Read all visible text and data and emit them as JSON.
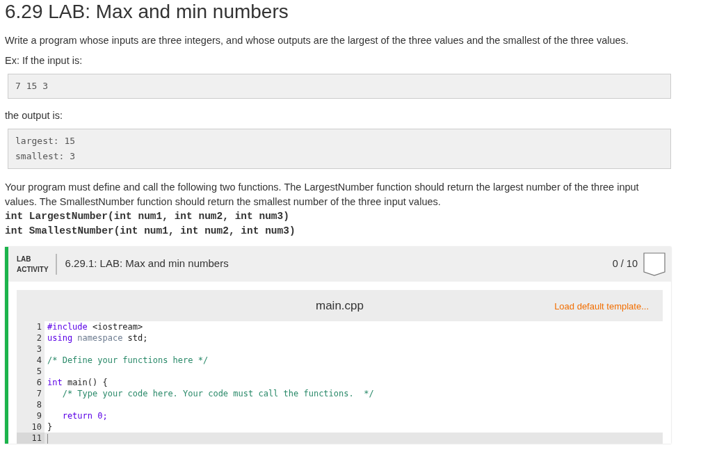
{
  "title": "6.29 LAB: Max and min numbers",
  "intro": "Write a program whose inputs are three integers, and whose outputs are the largest of the three values and the smallest of the three values.",
  "example_label": "Ex: If the input is:",
  "example_input": [
    "7 15 3"
  ],
  "output_label": "the output is:",
  "example_output": [
    "largest: 15",
    "smallest: 3"
  ],
  "functions_text": "Your program must define and call the following two functions. The LargestNumber function should return the largest number of the three input values. The SmallestNumber function should return the smallest number of the three input values.",
  "signatures": [
    "int LargestNumber(int num1, int num2, int num3)",
    "int SmallestNumber(int num1, int num2, int num3)"
  ],
  "activity": {
    "label_lines": [
      "LAB",
      "ACTIVITY"
    ],
    "title": "6.29.1: LAB: Max and min numbers",
    "score": "0 / 10"
  },
  "editor": {
    "filename": "main.cpp",
    "template_link": "Load default template...",
    "lines": [
      {
        "number": "1",
        "active": false,
        "tokens": [
          {
            "text": "#include",
            "kind": "keyword"
          },
          {
            "text": " <iostream>",
            "kind": "plain"
          }
        ]
      },
      {
        "number": "2",
        "active": false,
        "tokens": [
          {
            "text": "using",
            "kind": "keyword"
          },
          {
            "text": " namespace",
            "kind": "muted"
          },
          {
            "text": " std;",
            "kind": "plain"
          }
        ]
      },
      {
        "number": "3",
        "active": false
      },
      {
        "number": "4",
        "active": false,
        "tokens": [
          {
            "text": "/* Define your functions here */",
            "kind": "comment"
          }
        ]
      },
      {
        "number": "5",
        "active": false
      },
      {
        "number": "6",
        "active": false,
        "tokens": [
          {
            "text": "int",
            "kind": "keyword"
          },
          {
            "text": " main() {",
            "kind": "plain"
          }
        ]
      },
      {
        "number": "7",
        "active": false,
        "tokens": [
          {
            "text": "   /* Type your code here. Your code must call the functions.  */",
            "kind": "comment"
          }
        ]
      },
      {
        "number": "8",
        "active": false
      },
      {
        "number": "9",
        "active": false,
        "tokens": [
          {
            "text": "   return 0;",
            "kind": "keyword"
          }
        ]
      },
      {
        "number": "10",
        "active": false,
        "tokens": [
          {
            "text": "}",
            "kind": "plain"
          }
        ]
      },
      {
        "number": "11",
        "active": true
      }
    ]
  }
}
